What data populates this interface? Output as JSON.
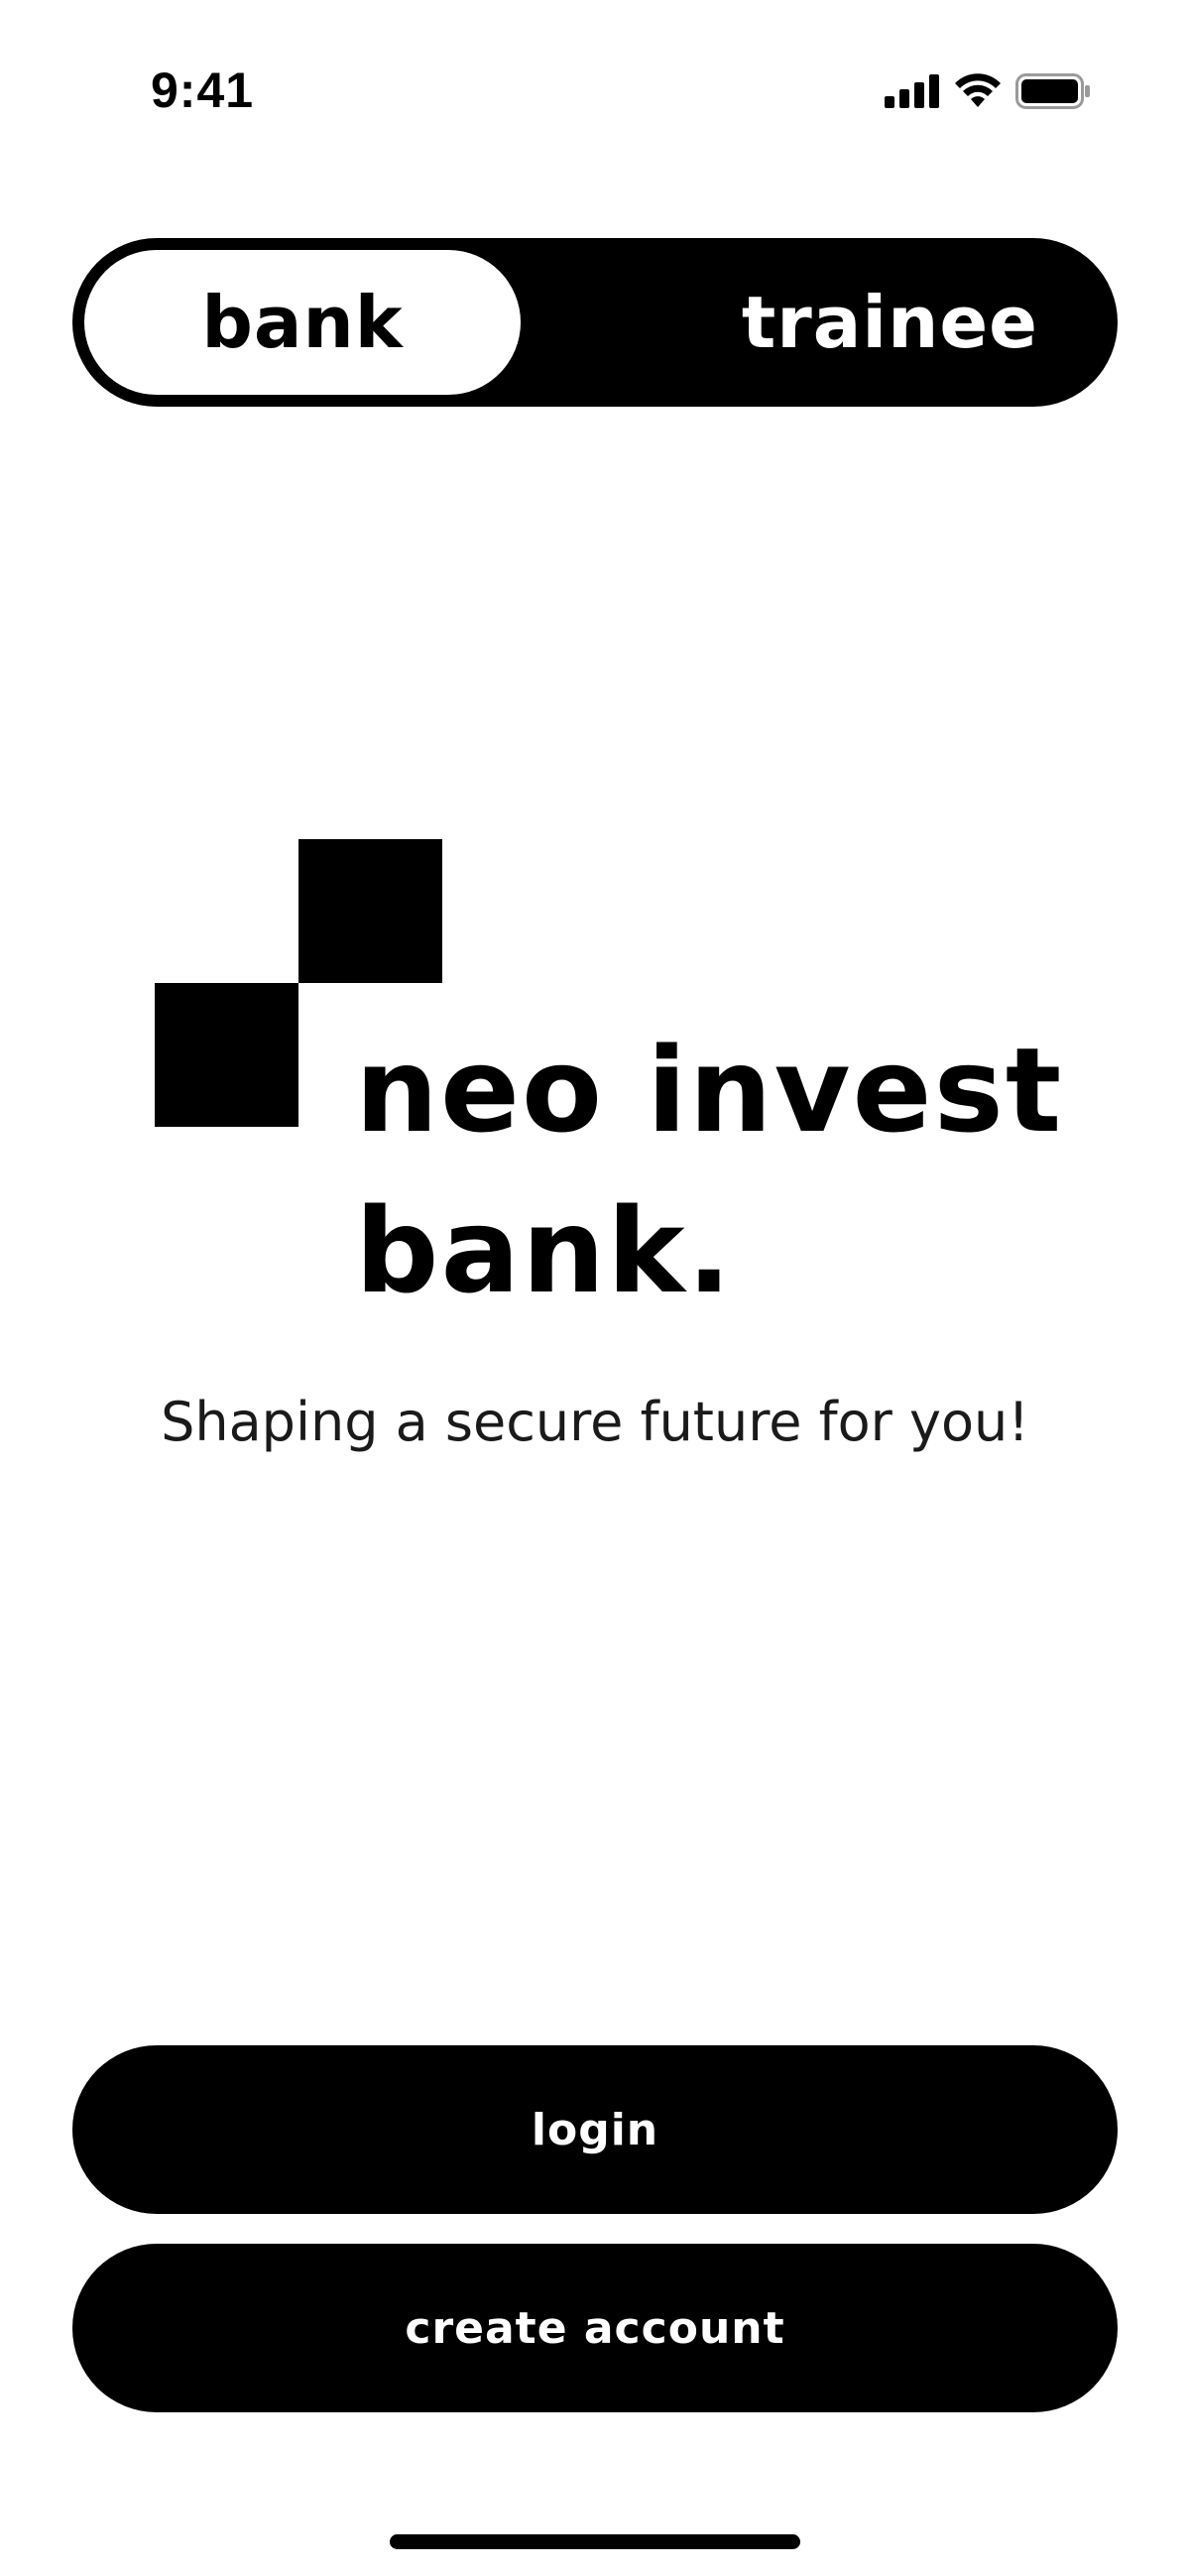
{
  "status_bar": {
    "time": "9:41",
    "icons": [
      "cellular-signal-icon",
      "wifi-icon",
      "battery-icon"
    ]
  },
  "toggle": {
    "options": [
      "bank",
      "trainee"
    ],
    "selected": "bank"
  },
  "brand": {
    "name_line1": "neo invest",
    "name_line2": "bank.",
    "tagline": "Shaping a secure future for you!"
  },
  "actions": {
    "login_label": "login",
    "create_account_label": "create account"
  },
  "colors": {
    "primary": "#000000",
    "background": "#ffffff"
  }
}
